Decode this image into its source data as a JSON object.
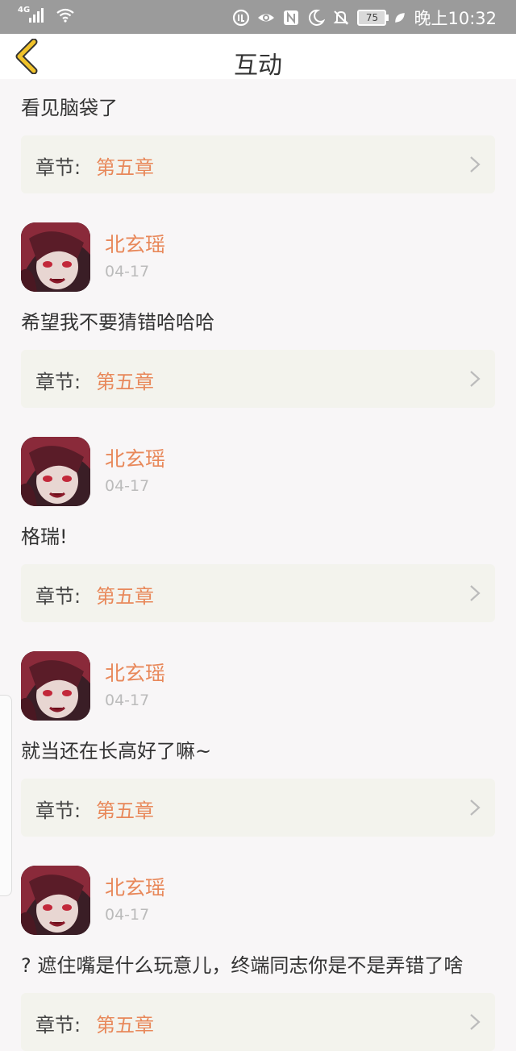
{
  "status_bar": {
    "network": "4G",
    "battery": "75",
    "time": "晚上10:32"
  },
  "header": {
    "title": "互动"
  },
  "first_comment": {
    "text": "看见脑袋了",
    "chapter_label": "章节:",
    "chapter_name": "第五章"
  },
  "comments": [
    {
      "username": "北玄瑶",
      "date": "04-17",
      "text": "希望我不要猜错哈哈哈",
      "chapter_label": "章节:",
      "chapter_name": "第五章"
    },
    {
      "username": "北玄瑶",
      "date": "04-17",
      "text": "格瑞!",
      "chapter_label": "章节:",
      "chapter_name": "第五章"
    },
    {
      "username": "北玄瑶",
      "date": "04-17",
      "text": "就当还在长高好了嘛~",
      "chapter_label": "章节:",
      "chapter_name": "第五章"
    },
    {
      "username": "北玄瑶",
      "date": "04-17",
      "text": "? 遮住嘴是什么玩意儿，终端同志你是不是弄错了啥",
      "chapter_label": "章节:",
      "chapter_name": "第五章"
    }
  ],
  "colors": {
    "accent": "#e8885a",
    "status_bar": "#9b9b9b",
    "chapter_bg": "#f3f3ed",
    "back_arrow": "#f0c22a"
  }
}
